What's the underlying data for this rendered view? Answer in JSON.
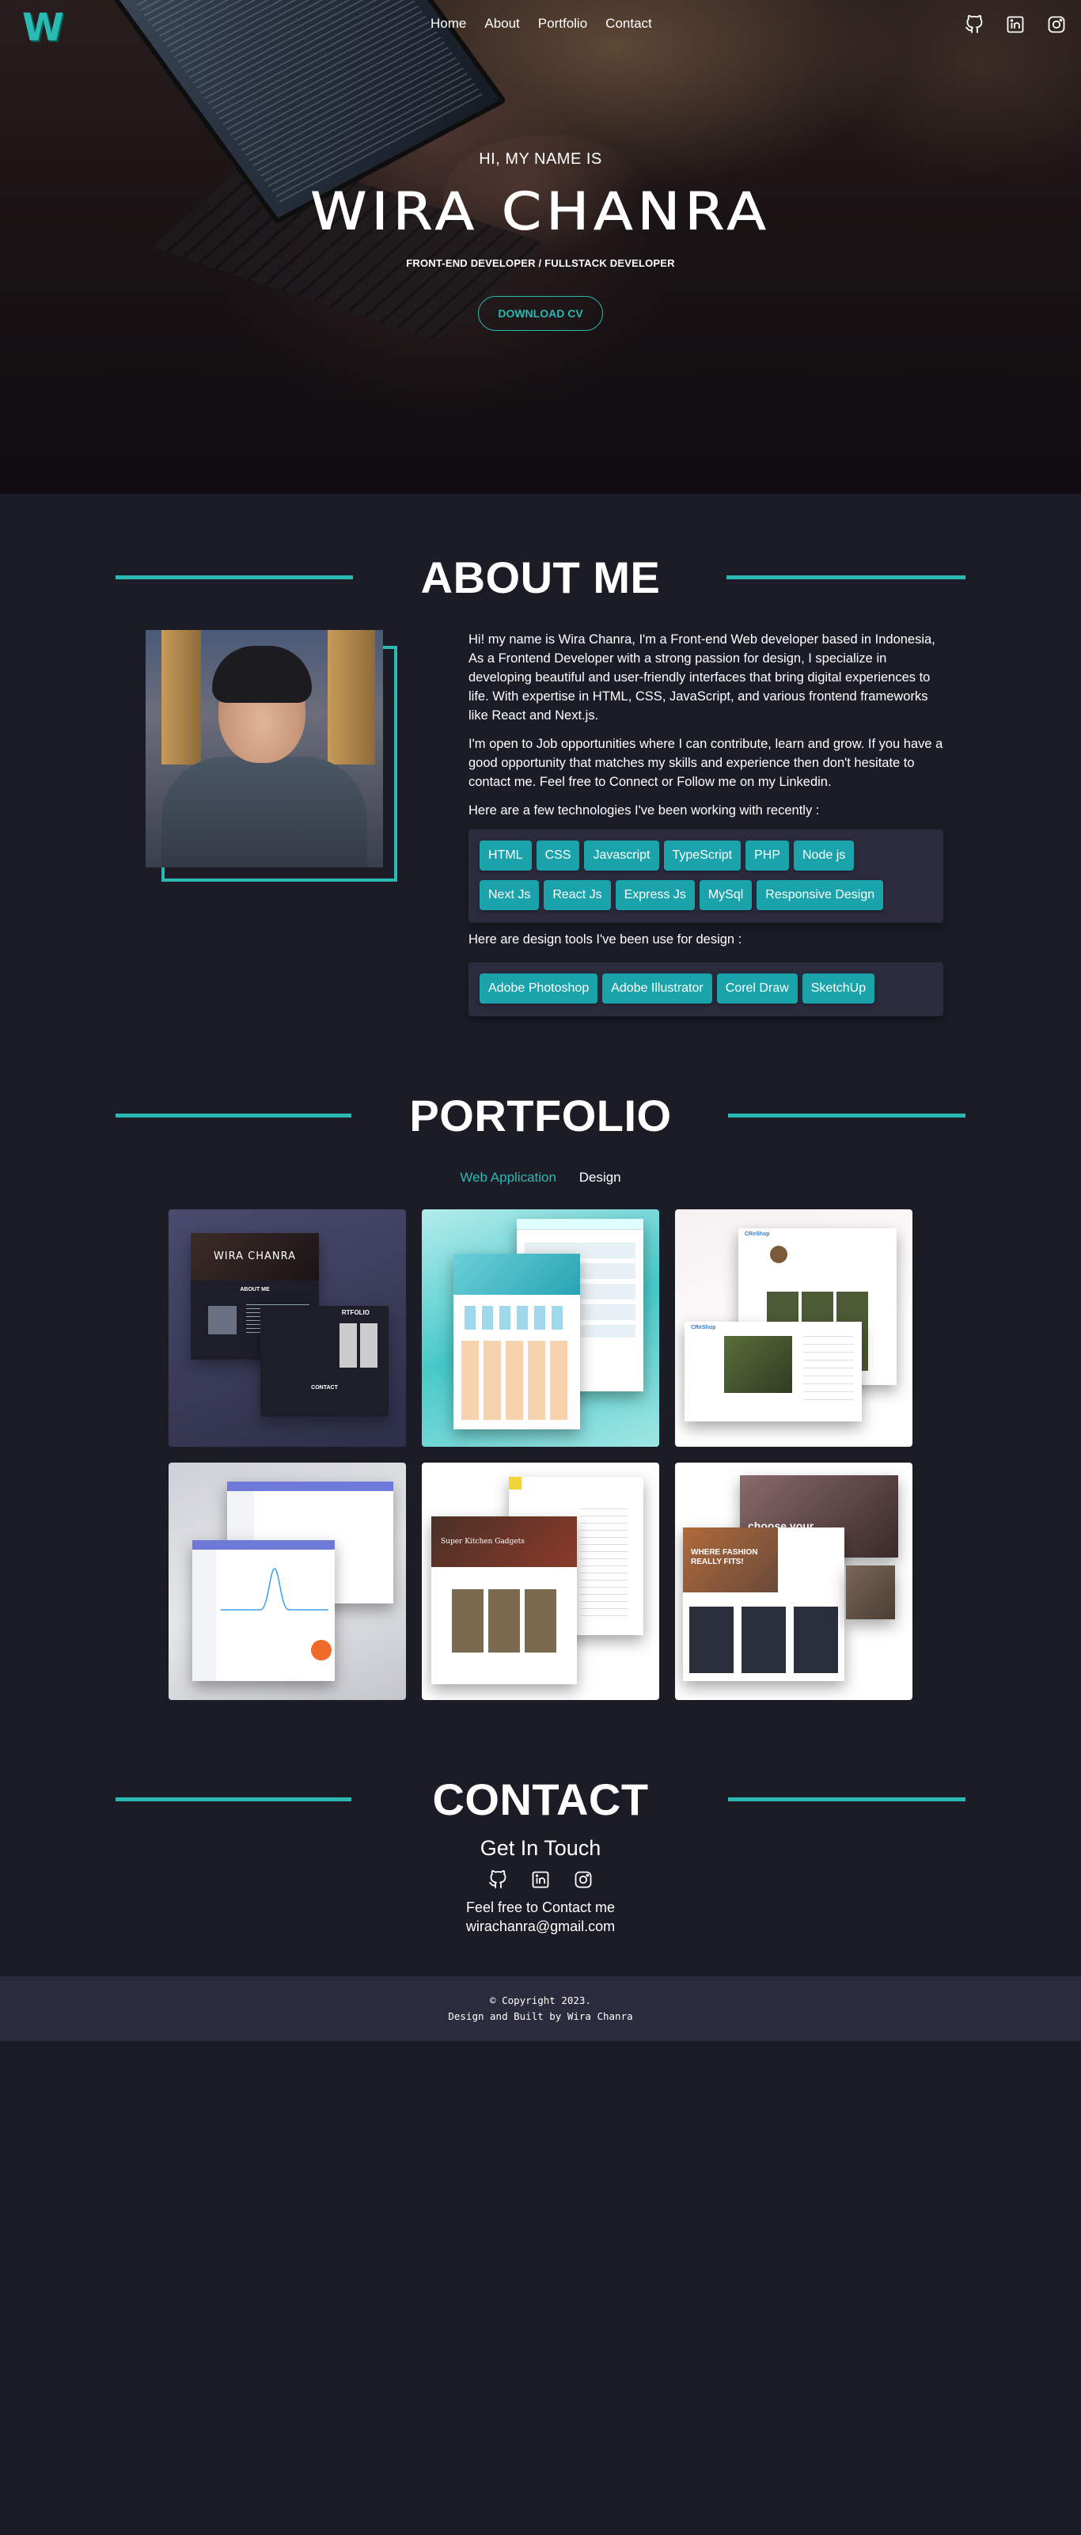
{
  "nav": {
    "links": [
      "Home",
      "About",
      "Portfolio",
      "Contact"
    ],
    "socials": [
      "github-icon",
      "linkedin-icon",
      "instagram-icon"
    ]
  },
  "hero": {
    "greeting": "HI, MY NAME IS",
    "name": "WIRA CHANRA",
    "role": "FRONT-END DEVELOPER / FULLSTACK DEVELOPER",
    "cv_button": "DOWNLOAD CV"
  },
  "about": {
    "title": "ABOUT ME",
    "p1": "Hi! my name is Wira Chanra, I'm a Front-end Web developer based in Indonesia, As a Frontend Developer with a strong passion for design, I specialize in developing beautiful and user-friendly interfaces that bring digital experiences to life. With expertise in HTML, CSS, JavaScript, and various frontend frameworks like React and Next.js.",
    "p2": "I'm open to Job opportunities where I can contribute, learn and grow. If you have a good opportunity that matches my skills and experience then don't hesitate to contact me. Feel free to Connect or Follow me on my  Linkedin.",
    "tech_heading": "Here are a few technologies I've been working with recently :",
    "tech": [
      "HTML",
      "CSS",
      "Javascript",
      "TypeScript",
      "PHP",
      "Node js",
      "Next Js",
      "React Js",
      "Express Js",
      "MySql",
      "Responsive Design"
    ],
    "design_heading": "Here are design tools I've been use for design :",
    "design_tools": [
      "Adobe Photoshop",
      "Adobe Illustrator",
      "Corel Draw",
      "SketchUp"
    ]
  },
  "portfolio": {
    "title": "PORTFOLIO",
    "tabs": [
      "Web Application",
      "Design"
    ],
    "active_tab": "Web Application",
    "card_texts": {
      "c1_title": "WIRA CHANRA",
      "c1_about": "ABOUT ME",
      "c1_portfolio": "RTFOLIO",
      "c1_contact": "CONTACT",
      "c3_brand": "CReShop",
      "c5_title": "Super Kitchen Gadgets",
      "c6_headline": "WHERE FASHION REALLY FITS!",
      "c6_hero": "choose your"
    }
  },
  "contact": {
    "title": "CONTACT",
    "subtitle": "Get In Touch",
    "note": "Feel free to Contact me",
    "email": "wirachanra@gmail.com"
  },
  "footer": {
    "line1": "© Copyright 2023.",
    "line2": "Design and Built by Wira Chanra"
  },
  "colors": {
    "accent": "#2bb9b3",
    "background": "#1b1c26",
    "panel": "#2a2b3d",
    "chip": "#1aa3ab"
  }
}
